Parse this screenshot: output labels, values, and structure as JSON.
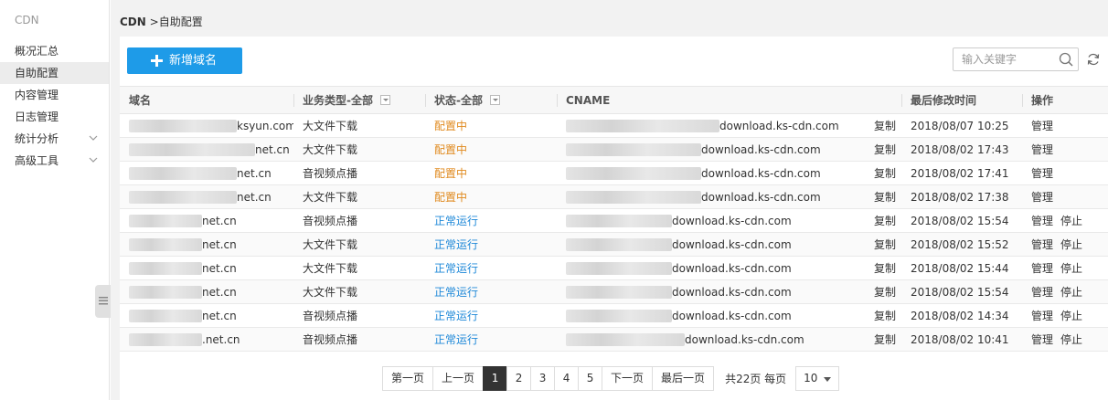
{
  "sidebar": {
    "title": "CDN",
    "items": [
      {
        "label": "概况汇总",
        "active": false,
        "expandable": false
      },
      {
        "label": "自助配置",
        "active": true,
        "expandable": false
      },
      {
        "label": "内容管理",
        "active": false,
        "expandable": false
      },
      {
        "label": "日志管理",
        "active": false,
        "expandable": false
      },
      {
        "label": "统计分析",
        "active": false,
        "expandable": true
      },
      {
        "label": "高级工具",
        "active": false,
        "expandable": true
      }
    ]
  },
  "breadcrumb": {
    "root": "CDN",
    "separator": ">",
    "current": "自助配置"
  },
  "toolbar": {
    "add_label": "新增域名",
    "search_placeholder": "输入关键字"
  },
  "columns": {
    "domain": "域名",
    "biz": "业务类型-全部",
    "status": "状态-全部",
    "cname": "CNAME",
    "modified": "最后修改时间",
    "ops": "操作"
  },
  "rows": [
    {
      "domain": "ksyun.com",
      "biz": "大文件下载",
      "status": "配置中",
      "status_kind": "config",
      "cname": "download.ks-cdn.com",
      "copy": "复制",
      "modified": "2018/08/07 10:25",
      "manage": "管理",
      "stop": ""
    },
    {
      "domain": "net.cn",
      "biz": "大文件下载",
      "status": "配置中",
      "status_kind": "config",
      "cname": "download.ks-cdn.com",
      "copy": "复制",
      "modified": "2018/08/02 17:43",
      "manage": "管理",
      "stop": ""
    },
    {
      "domain": "net.cn",
      "biz": "音视频点播",
      "status": "配置中",
      "status_kind": "config",
      "cname": "download.ks-cdn.com",
      "copy": "复制",
      "modified": "2018/08/02 17:41",
      "manage": "管理",
      "stop": ""
    },
    {
      "domain": "net.cn",
      "biz": "大文件下载",
      "status": "配置中",
      "status_kind": "config",
      "cname": "download.ks-cdn.com",
      "copy": "复制",
      "modified": "2018/08/02 17:38",
      "manage": "管理",
      "stop": ""
    },
    {
      "domain": "net.cn",
      "biz": "音视频点播",
      "status": "正常运行",
      "status_kind": "run",
      "cname": "download.ks-cdn.com",
      "copy": "复制",
      "modified": "2018/08/02 15:54",
      "manage": "管理",
      "stop": "停止"
    },
    {
      "domain": "net.cn",
      "biz": "大文件下载",
      "status": "正常运行",
      "status_kind": "run",
      "cname": "download.ks-cdn.com",
      "copy": "复制",
      "modified": "2018/08/02 15:52",
      "manage": "管理",
      "stop": "停止"
    },
    {
      "domain": "net.cn",
      "biz": "大文件下载",
      "status": "正常运行",
      "status_kind": "run",
      "cname": "download.ks-cdn.com",
      "copy": "复制",
      "modified": "2018/08/02 15:44",
      "manage": "管理",
      "stop": "停止"
    },
    {
      "domain": "net.cn",
      "biz": "大文件下载",
      "status": "正常运行",
      "status_kind": "run",
      "cname": "download.ks-cdn.com",
      "copy": "复制",
      "modified": "2018/08/02 15:54",
      "manage": "管理",
      "stop": "停止"
    },
    {
      "domain": "net.cn",
      "biz": "音视频点播",
      "status": "正常运行",
      "status_kind": "run",
      "cname": "download.ks-cdn.com",
      "copy": "复制",
      "modified": "2018/08/02 14:34",
      "manage": "管理",
      "stop": "停止"
    },
    {
      "domain": ".net.cn",
      "biz": "音视频点播",
      "status": "正常运行",
      "status_kind": "run",
      "cname": "download.ks-cdn.com",
      "copy": "复制",
      "modified": "2018/08/02 10:41",
      "manage": "管理",
      "stop": "停止"
    }
  ],
  "pagination": {
    "first": "第一页",
    "prev": "上一页",
    "pages": [
      "1",
      "2",
      "3",
      "4",
      "5"
    ],
    "current": "1",
    "next": "下一页",
    "last": "最后一页",
    "total_text": "共22页 每页",
    "page_size": "10"
  },
  "colors": {
    "accent": "#1e9be8",
    "status_config": "#e08a1e",
    "status_run": "#1e88d8"
  }
}
